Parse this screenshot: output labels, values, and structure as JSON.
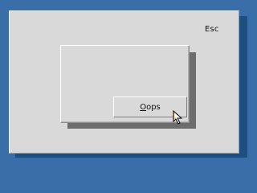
{
  "panel": {
    "esc_label": "Esc"
  },
  "dialog": {
    "button": {
      "mnemonic": "O",
      "label_rest": "ops"
    }
  },
  "cursor": {
    "icon": "arrow-cursor-icon"
  },
  "colors": {
    "desktop": "#396ea8",
    "panel": "#d9d9d9",
    "shadow": "#6d6d6d"
  }
}
